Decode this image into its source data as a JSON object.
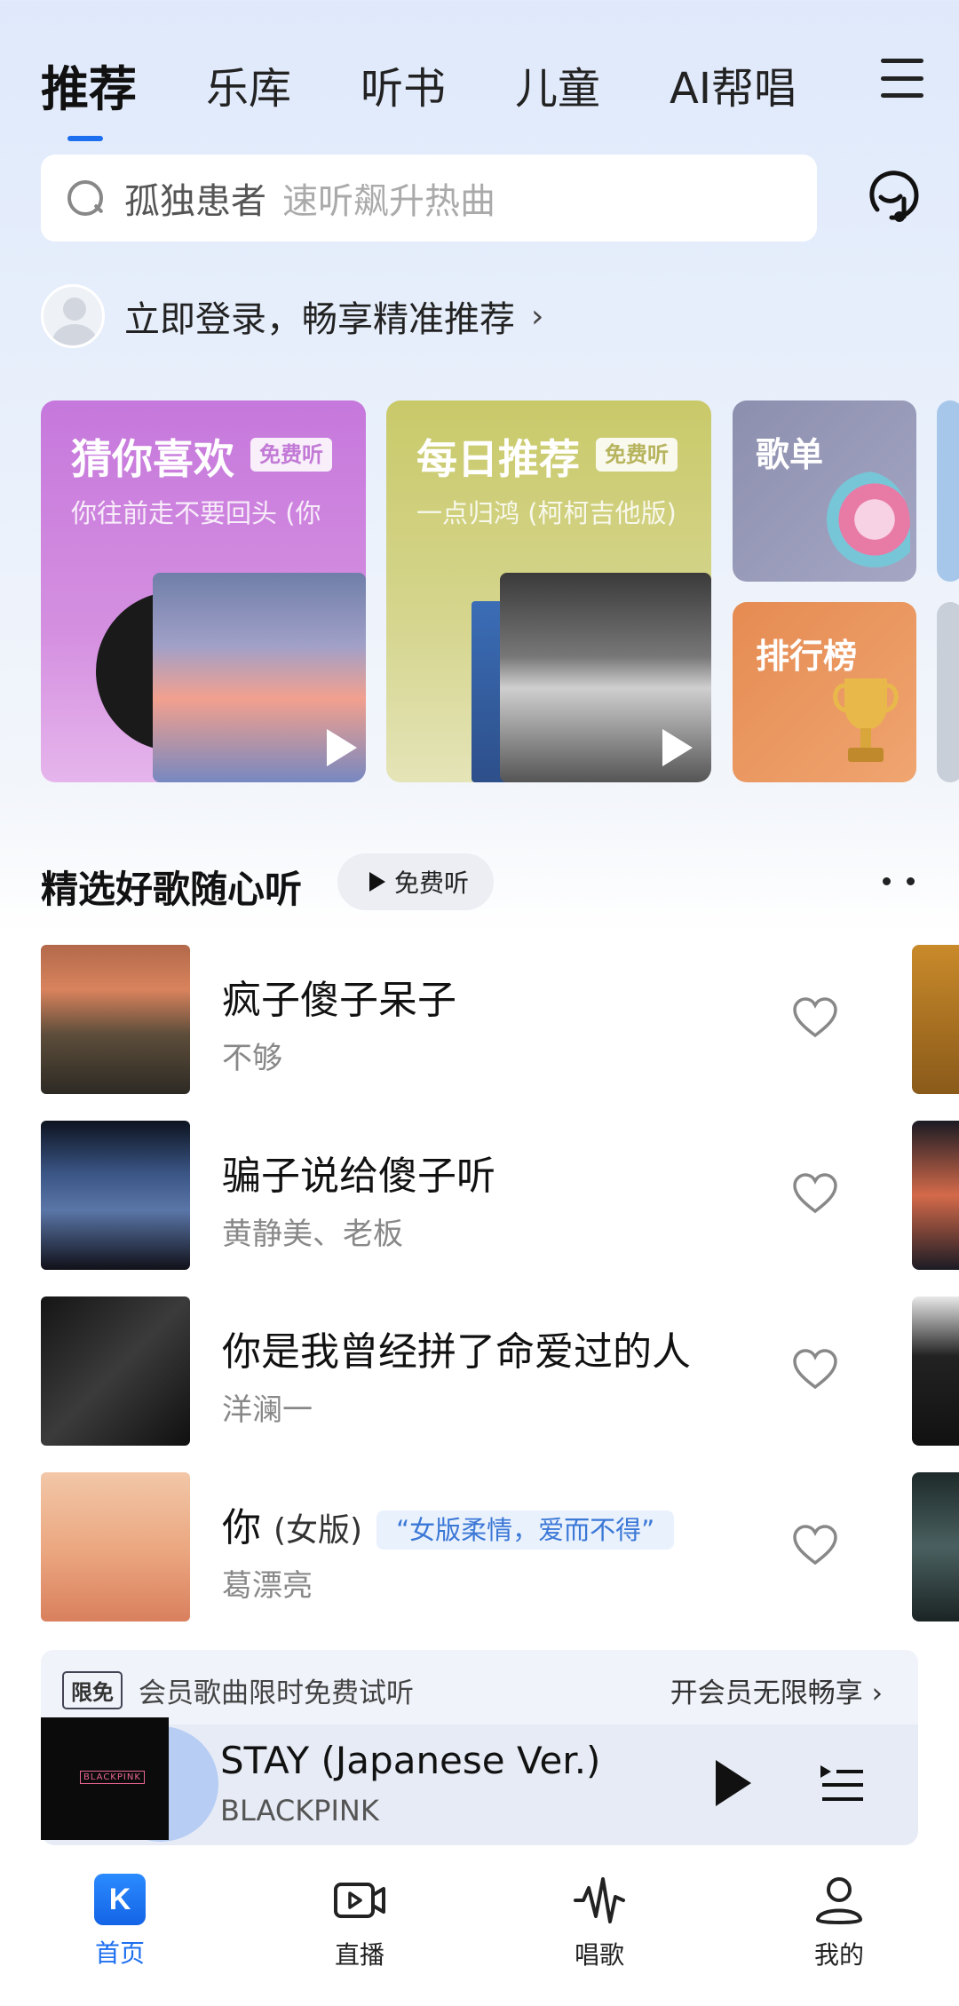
{
  "top_tabs": [
    {
      "label": "推荐",
      "active": true
    },
    {
      "label": "乐库",
      "active": false
    },
    {
      "label": "听书",
      "active": false
    },
    {
      "label": "儿童",
      "active": false
    },
    {
      "label": "AI帮唱",
      "active": false
    }
  ],
  "search": {
    "term": "孤独患者",
    "hint": "速听飙升热曲"
  },
  "login": {
    "text": "立即登录，畅享精准推荐",
    "chevron": "›"
  },
  "cards": {
    "guess": {
      "title": "猜你喜欢",
      "badge": "免费听",
      "subtitle": "你往前走不要回头 (你"
    },
    "daily": {
      "title": "每日推荐",
      "badge": "免费听",
      "subtitle": "一点归鸿 (柯柯吉他版)"
    },
    "playlist": {
      "title": "歌单"
    },
    "ranking": {
      "title": "排行榜"
    }
  },
  "section": {
    "title": "精选好歌随心听",
    "pill": "免费听"
  },
  "songs": [
    {
      "title": "疯子傻子呆子",
      "artist": "不够"
    },
    {
      "title": "骗子说给傻子听",
      "artist": "黄静美、老板"
    },
    {
      "title": "你是我曾经拼了命爱过的人",
      "artist": "洋澜一"
    },
    {
      "title": "你",
      "version": "(女版)",
      "tag": "“女版柔情，爱而不得”",
      "artist": "葛漂亮"
    }
  ],
  "vip_banner": {
    "badge": "限免",
    "text": "会员歌曲限时免费试听",
    "link": "开会员无限畅享 ›"
  },
  "player": {
    "title": "STAY (Japanese Ver.)",
    "artist": "BLACKPINK",
    "cover_logo": "BLACKPINK"
  },
  "bottom_nav": [
    {
      "label": "首页",
      "icon": "home-k-icon",
      "active": true
    },
    {
      "label": "直播",
      "icon": "live-video-icon",
      "active": false
    },
    {
      "label": "唱歌",
      "icon": "sing-wave-icon",
      "active": false
    },
    {
      "label": "我的",
      "icon": "profile-icon",
      "active": false
    }
  ],
  "colors": {
    "accent": "#1e6ff0",
    "tag_blue": "#3b78d6"
  }
}
